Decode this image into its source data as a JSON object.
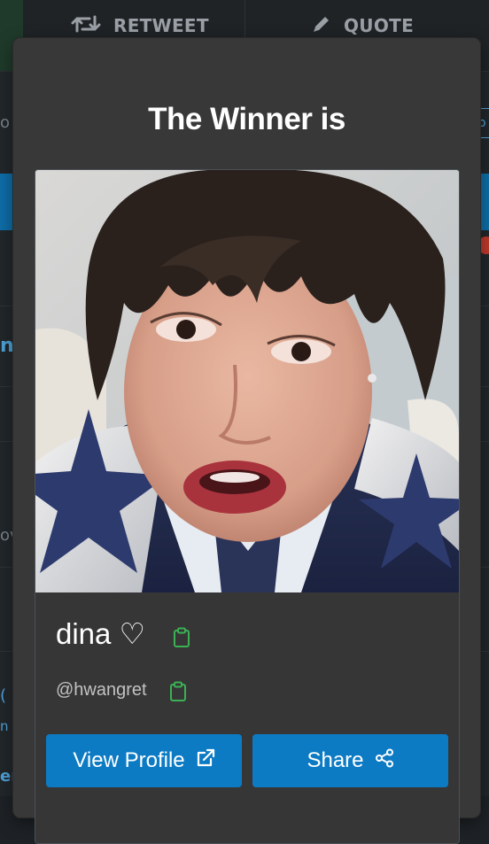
{
  "background": {
    "tabs": {
      "retweet_label": "RETWEET",
      "quote_label": "QUOTE"
    },
    "edge_texts": [
      "o a",
      "n",
      "ov",
      "(",
      "n p",
      "er"
    ],
    "right_box_text": "o"
  },
  "modal": {
    "title": "The Winner is",
    "winner": {
      "name": "dina ♡",
      "handle": "@hwangret"
    },
    "buttons": {
      "view_profile": "View Profile",
      "share": "Share"
    }
  },
  "colors": {
    "accent_blue": "#0d7bc4",
    "copy_green": "#3bb154",
    "modal_bg": "#383838"
  },
  "icons": {
    "retweet": "retweet-icon",
    "quote": "pencil-icon",
    "copy": "clipboard-icon",
    "external_link": "external-link-icon",
    "share": "share-icon"
  }
}
